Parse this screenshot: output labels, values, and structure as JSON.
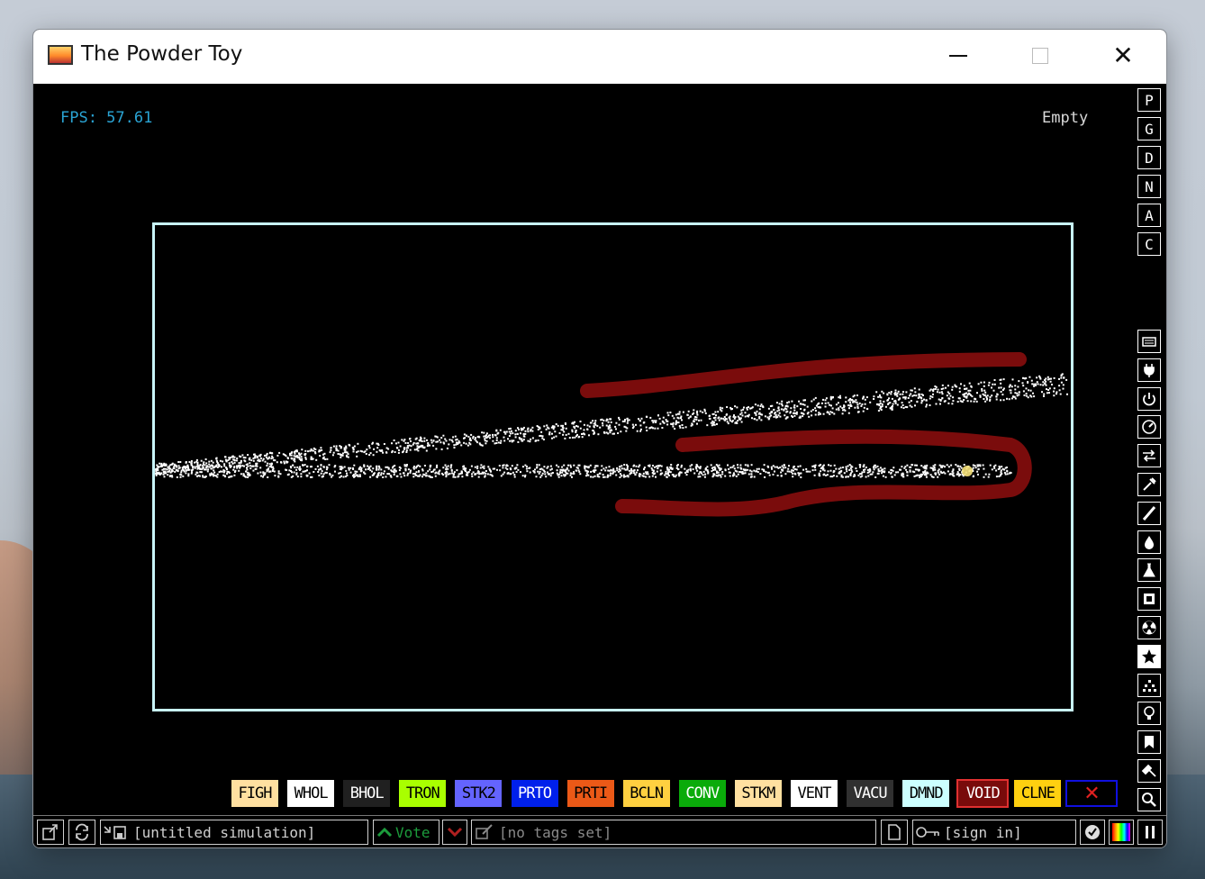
{
  "window": {
    "title": "The Powder Toy"
  },
  "overlay": {
    "fps": "FPS: 57.61",
    "hover_element": "Empty"
  },
  "right_menu": {
    "top_buttons": [
      "P",
      "G",
      "D",
      "N",
      "A",
      "C"
    ],
    "categories": [
      {
        "icon": "keyboard-icon"
      },
      {
        "icon": "plug-icon"
      },
      {
        "icon": "power-icon"
      },
      {
        "icon": "gauge-icon"
      },
      {
        "icon": "arrows-icon"
      },
      {
        "icon": "tools-icon"
      },
      {
        "icon": "brush-icon"
      },
      {
        "icon": "droplet-icon"
      },
      {
        "icon": "flask-icon"
      },
      {
        "icon": "square-icon"
      },
      {
        "icon": "radiation-icon"
      },
      {
        "icon": "star-icon",
        "active": true
      },
      {
        "icon": "dots-icon"
      },
      {
        "icon": "lightbulb-icon"
      },
      {
        "icon": "bookmark-icon"
      },
      {
        "icon": "hammer-icon"
      },
      {
        "icon": "search-icon"
      }
    ]
  },
  "element_palette": [
    {
      "label": "FIGH",
      "bg": "#ffe0a0",
      "fg": "#000000"
    },
    {
      "label": "WHOL",
      "bg": "#ffffff",
      "fg": "#000000"
    },
    {
      "label": "BHOL",
      "bg": "#202020",
      "fg": "#ffffff"
    },
    {
      "label": "TRON",
      "bg": "#a9ff00",
      "fg": "#000000"
    },
    {
      "label": "STK2",
      "bg": "#6464ff",
      "fg": "#000000"
    },
    {
      "label": "PRTO",
      "bg": "#0020eb",
      "fg": "#ffffff"
    },
    {
      "label": "PRTI",
      "bg": "#eb5917",
      "fg": "#000000"
    },
    {
      "label": "BCLN",
      "bg": "#ffd040",
      "fg": "#000000"
    },
    {
      "label": "CONV",
      "bg": "#0aab0a",
      "fg": "#ffffff"
    },
    {
      "label": "STKM",
      "bg": "#ffe0a0",
      "fg": "#000000"
    },
    {
      "label": "VENT",
      "bg": "#ffffff",
      "fg": "#000000"
    },
    {
      "label": "VACU",
      "bg": "#303030",
      "fg": "#ffffff"
    },
    {
      "label": "DMND",
      "bg": "#ccffff",
      "fg": "#000000"
    },
    {
      "label": "VOID",
      "bg": "#790b0b",
      "fg": "#ffffff",
      "selected": true
    },
    {
      "label": "CLNE",
      "bg": "#ffd010",
      "fg": "#000000"
    }
  ],
  "eraser": {
    "glyph": "✕",
    "color": "#e02020",
    "border": "#1010e0"
  },
  "bottom_bar": {
    "save_title": "[untitled simulation]",
    "vote_label": "Vote",
    "tags": "[no tags set]",
    "sign_in": "[sign in]"
  },
  "colors": {
    "sim_border": "#c8f4f8",
    "fps_text": "#2aa4d4",
    "powder": "#ffffff",
    "void_wall": "#7a0c0c"
  }
}
